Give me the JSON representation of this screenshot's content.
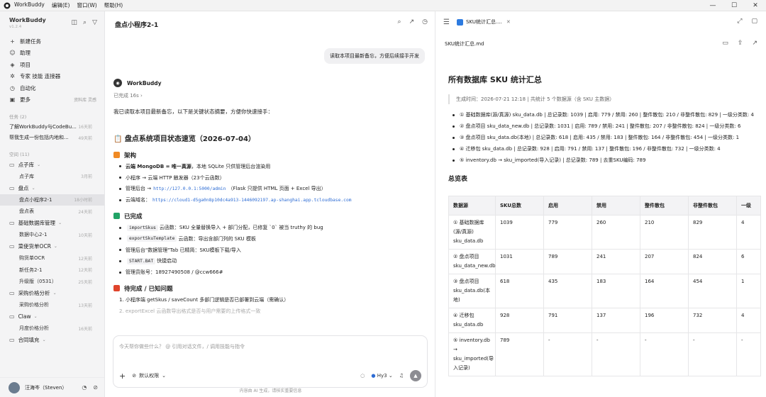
{
  "titlebar": {
    "app": "WorkBuddy",
    "menus": [
      "编辑(E)",
      "窗口(W)",
      "帮助(H)"
    ],
    "win": [
      "—",
      "☐",
      "✕"
    ]
  },
  "sidebar": {
    "brand": "WorkBuddy",
    "version": "v1.2.4",
    "nav": [
      {
        "icon": "+",
        "label": "新建任务",
        "extra": ""
      },
      {
        "icon": "☺",
        "label": "助理",
        "extra": ""
      },
      {
        "icon": "◈",
        "label": "项目",
        "extra": ""
      },
      {
        "icon": "✲",
        "label": "专家 技能 连接器",
        "extra": ""
      },
      {
        "icon": "◷",
        "label": "自动化",
        "extra": ""
      },
      {
        "icon": "▣",
        "label": "更多",
        "extra": "资料库 灵感"
      }
    ],
    "tasks_title": "任务 (2)",
    "tasks": [
      {
        "label": "了解WorkBuddy与CodeBu...",
        "time": "16天前"
      },
      {
        "label": "帮我生成一份包括内地和...",
        "time": "49天前"
      }
    ],
    "spaces_title": "空间 (11)",
    "folders": [
      {
        "label": "点子库",
        "subs": [
          {
            "label": "点子库",
            "time": "3月前",
            "active": false
          }
        ]
      },
      {
        "label": "盘点",
        "subs": [
          {
            "label": "盘点小程序2-1",
            "time": "18小时前",
            "active": true
          },
          {
            "label": "盘点表",
            "time": "24天前",
            "active": false
          }
        ]
      },
      {
        "label": "基础数据库管理",
        "subs": [
          {
            "label": "数据中心2-1",
            "time": "10天前",
            "active": false
          }
        ]
      },
      {
        "label": "菜使货单OCR",
        "subs": [
          {
            "label": "购货单OCR",
            "time": "12天前",
            "active": false
          },
          {
            "label": "新任务2-1",
            "time": "12天前",
            "active": false
          },
          {
            "label": "升级版（0531）",
            "time": "25天前",
            "active": false
          }
        ]
      },
      {
        "label": "采购价格分析",
        "subs": [
          {
            "label": "采购价格分析",
            "time": "13天前",
            "active": false
          }
        ]
      },
      {
        "label": "Claw",
        "subs": [
          {
            "label": "月度价格分析",
            "time": "16天前",
            "active": false
          }
        ]
      },
      {
        "label": "合同填充",
        "subs": []
      }
    ],
    "user": "汪海岑（Steven）"
  },
  "chat": {
    "title": "盘点小程序2-1",
    "bubble": "读取本项目最新备忘，方便后续接手开发",
    "assistant": "WorkBuddy",
    "done": "已完成 16s  ›",
    "intro": "我已读取本项目最新备忘，以下是关键状态摘要，方便你快速接手：",
    "h1": "📋  盘点系统项目状态速览（2026-07-04）",
    "arch_title": "架构",
    "arch": [
      {
        "pre": "云端 MongoDB = 唯一真源",
        "post": "，本地 SQLite 只供管理后台渲染用"
      },
      {
        "pre": "小程序 → 云端 HTTP 触发器（23个云函数）",
        "post": ""
      },
      {
        "pre": "管理后台 → ",
        "link": "http://127.0.0.1:5000/admin",
        "post": "（Flask 只提供 HTML 页面 + Excel 导出）"
      },
      {
        "pre": "云端域名：",
        "link": "https://cloud1-d5ga0n8p10dc4a913-1446092197.ap-shanghai.app.tcloudbase.com",
        "post": ""
      }
    ],
    "done_title": "已完成",
    "done_items": [
      {
        "code": "importSkus",
        "post": " 云函数：SKU 全量替换导入 + 部门分配，已修复 `0` 被当 truthy 的 bug"
      },
      {
        "code": "exportSkuTemplate",
        "post": " 云函数：导出含部门列的 SKU 模板"
      },
      {
        "code": "",
        "post": "管理后台\"数据管理\"Tab 已精简：SKU模板下载/导入"
      },
      {
        "code": "START.BAT",
        "post": " 快捷启动"
      },
      {
        "code": "",
        "post": "管理员账号：18927490508 / @ccw666#"
      }
    ],
    "todo_title": "待完成 / 已知问题",
    "todo": [
      "1. 小程序端 getSkus / saveCount 多部门逻辑是否已部署到云端（需确认）",
      "2. exportExcel 云函数导出格式是否与用户需要的上传格式一致"
    ],
    "placeholder": "今天帮你做些什么？ @ 引用对话文件，/ 调用技能与指令",
    "perm": "默认权限",
    "model": "Hy3",
    "footnote": "内容由 AI 生成，请核实重要信息"
  },
  "panel": {
    "tab": "SKU统计汇总....",
    "file": "SKU统计汇总.md",
    "title": "所有数据库 SKU 统计汇总",
    "meta": "生成时间：2026-07-21 12:18 | 共统计 5 个数据源（含 SKU 主数据）",
    "bullets": [
      "① 基础数据库(源/真源) sku_data.db | 总记录数: 1039 | 启用: 779 / 禁用: 260 | 整件散包: 210 / 非整件散包: 829 | 一级分类数: 4",
      "② 盘点项目 sku_data_new.db | 总记录数: 1031 | 启用: 789 / 禁用: 241 | 整件散包: 207 / 非整件散包: 824 | 一级分类数: 6",
      "③ 盘点项目 sku_data.db(本地) | 总记录数: 618 | 启用: 435 / 禁用: 183 | 整件散包: 164 / 非整件散包: 454 | 一级分类数: 1",
      "④ 迁移包 sku_data.db | 总记录数: 928 | 启用: 791 / 禁用: 137 | 整件散包: 196 / 非整件散包: 732 | 一级分类数: 4",
      "⑤ inventory.db → sku_imported(导入记录) | 总记录数: 789 | 去重SKU编码: 789"
    ],
    "overview": "总览表",
    "headers": [
      "数据源",
      "SKU总数",
      "启用",
      "禁用",
      "整件散包",
      "非整件散包",
      "一级"
    ],
    "rows": [
      [
        "① 基础数据库 (源/真源) sku_data.db",
        "1039",
        "779",
        "260",
        "210",
        "829",
        "4"
      ],
      [
        "② 盘点项目 sku_data_new.db",
        "1031",
        "789",
        "241",
        "207",
        "824",
        "6"
      ],
      [
        "③ 盘点项目 sku_data.db(本地)",
        "618",
        "435",
        "183",
        "164",
        "454",
        "1"
      ],
      [
        "④ 迁移包 sku_data.db",
        "928",
        "791",
        "137",
        "196",
        "732",
        "4"
      ],
      [
        "⑤ inventory.db → sku_imported(导入记录)",
        "789",
        "-",
        "-",
        "-",
        "-",
        "-"
      ]
    ],
    "colors": {
      "accent": "#2d6cd4",
      "done": "#21a366",
      "todo": "#e0442b",
      "arch": "#f08a24"
    }
  }
}
